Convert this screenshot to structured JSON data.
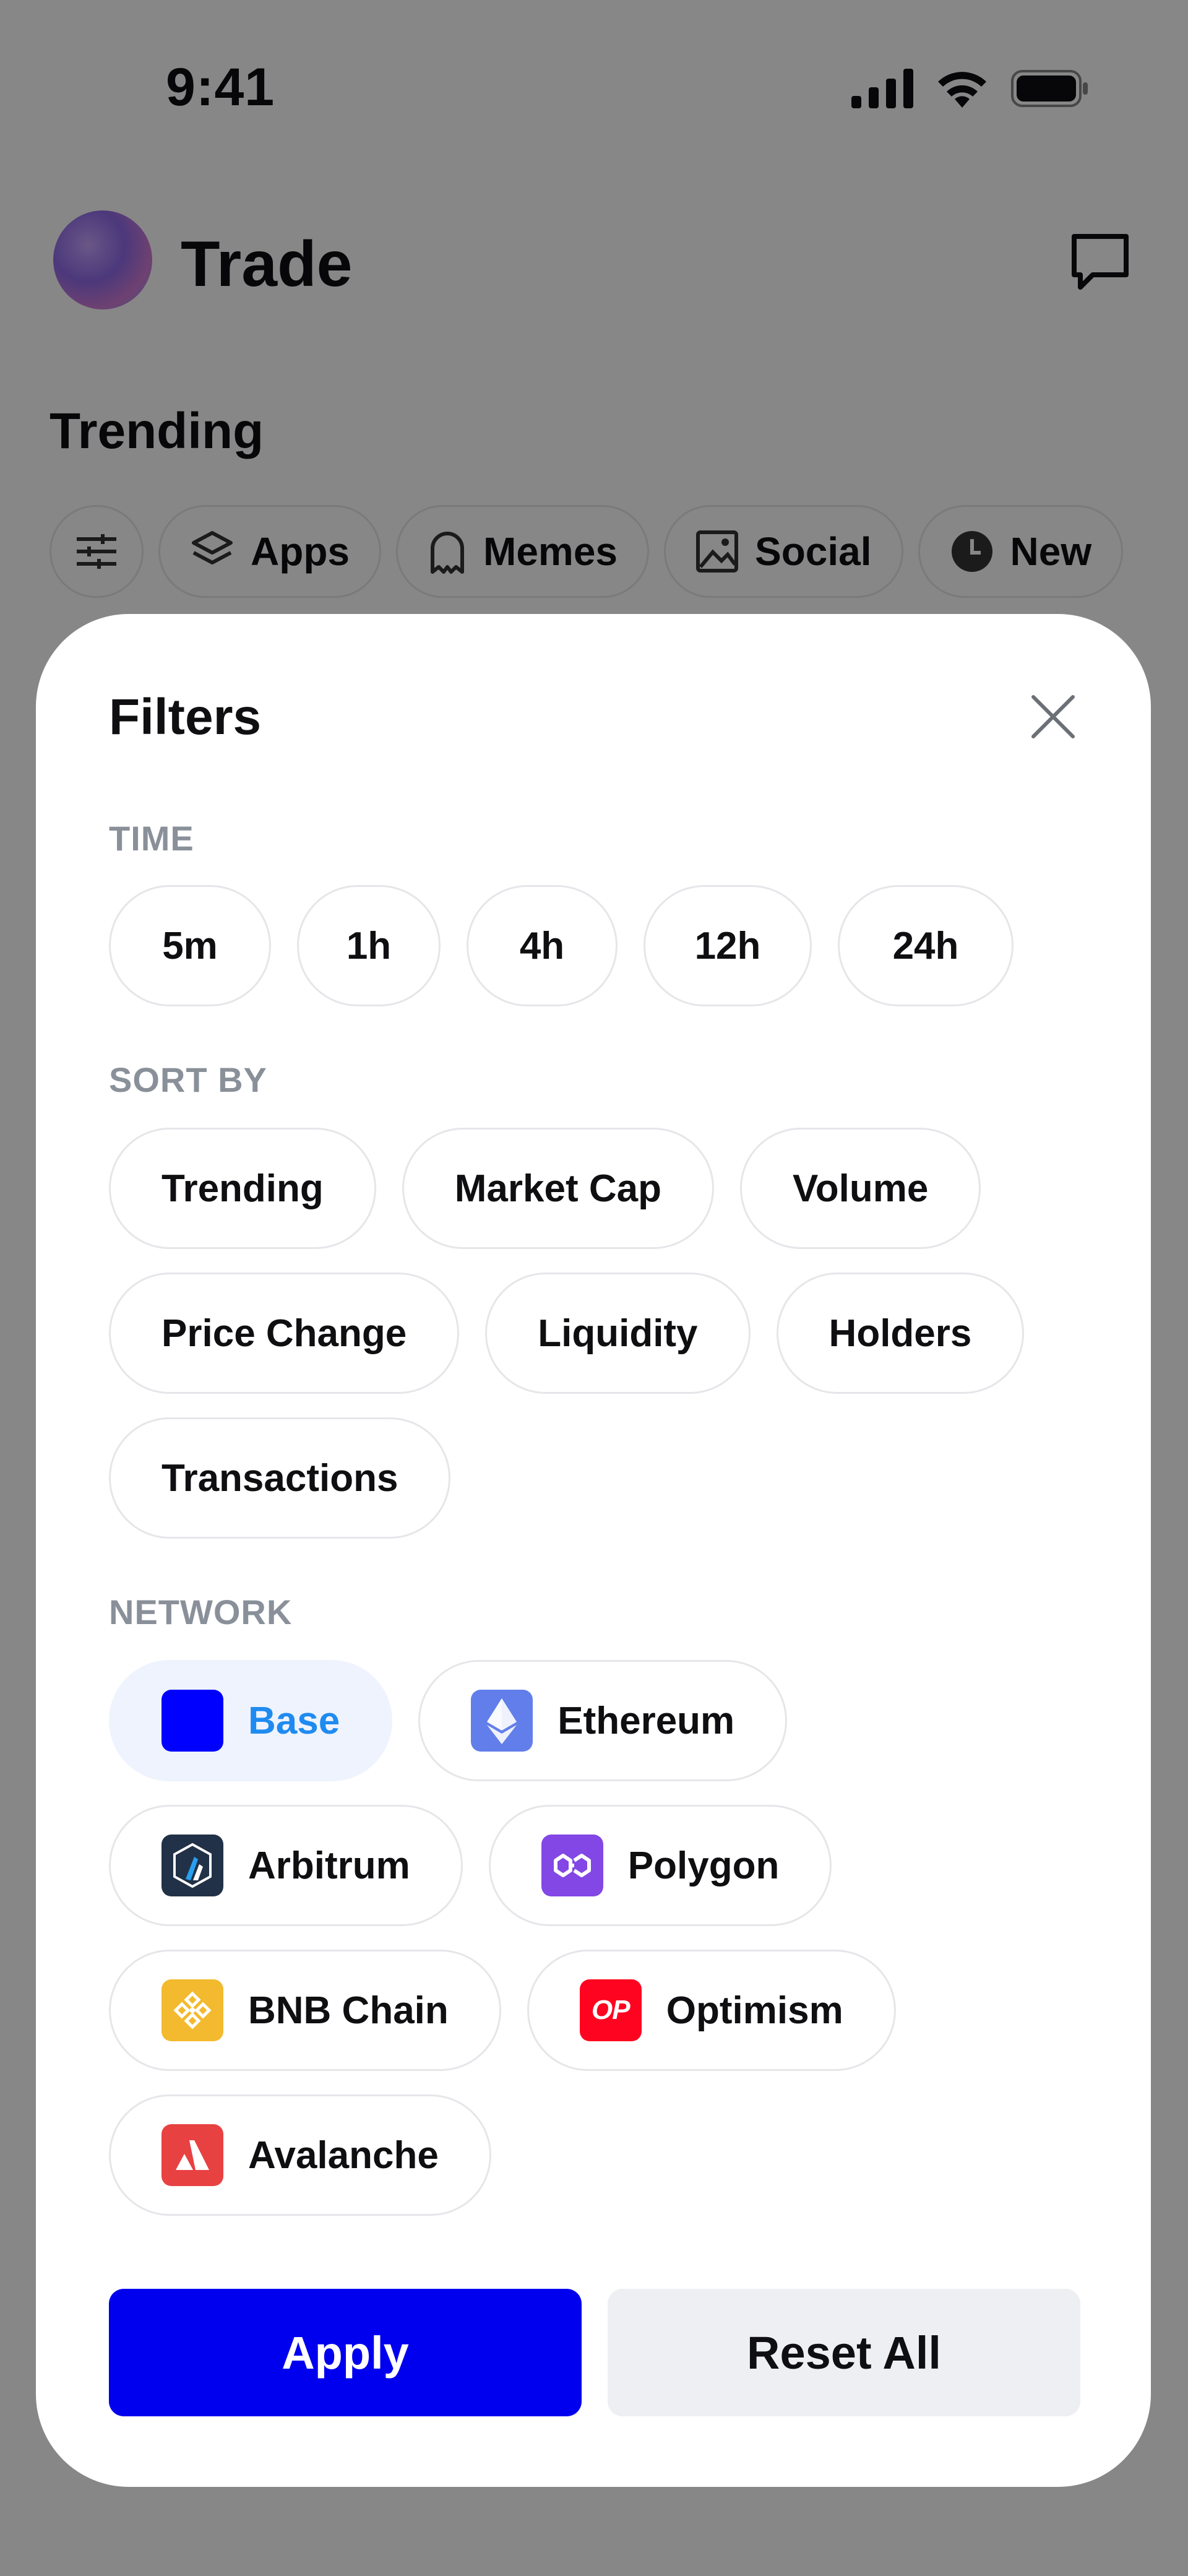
{
  "status_bar": {
    "time": "9:41"
  },
  "header": {
    "title": "Trade"
  },
  "trending": {
    "title": "Trending",
    "categories": [
      {
        "label": "",
        "icon": "sliders-icon"
      },
      {
        "label": "Apps",
        "icon": "layers-icon"
      },
      {
        "label": "Memes",
        "icon": "ghost-icon"
      },
      {
        "label": "Social",
        "icon": "image-icon"
      },
      {
        "label": "New",
        "icon": "clock-icon"
      }
    ]
  },
  "filters": {
    "title": "Filters",
    "time": {
      "label": "TIME",
      "options": [
        "5m",
        "1h",
        "4h",
        "12h",
        "24h"
      ]
    },
    "sort_by": {
      "label": "SORT BY",
      "options": [
        "Trending",
        "Market Cap",
        "Volume",
        "Price Change",
        "Liquidity",
        "Holders",
        "Transactions"
      ]
    },
    "network": {
      "label": "NETWORK",
      "options": [
        {
          "label": "Base",
          "icon": "base-icon",
          "color": "#0000ff",
          "selected": true
        },
        {
          "label": "Ethereum",
          "icon": "ethereum-icon",
          "color": "#627eea",
          "selected": false
        },
        {
          "label": "Arbitrum",
          "icon": "arbitrum-icon",
          "color": "#213147",
          "selected": false
        },
        {
          "label": "Polygon",
          "icon": "polygon-icon",
          "color": "#8247e5",
          "selected": false
        },
        {
          "label": "BNB Chain",
          "icon": "bnb-icon",
          "color": "#f3ba2f",
          "selected": false
        },
        {
          "label": "Optimism",
          "icon": "optimism-icon",
          "color": "#ff0420",
          "selected": false
        },
        {
          "label": "Avalanche",
          "icon": "avalanche-icon",
          "color": "#e84142",
          "selected": false
        }
      ]
    },
    "apply_label": "Apply",
    "reset_label": "Reset All"
  },
  "colors": {
    "primary": "#0000ef",
    "selected_text": "#1f8bf0",
    "selected_bg": "#eff3fe",
    "muted_label": "#8a9099"
  }
}
